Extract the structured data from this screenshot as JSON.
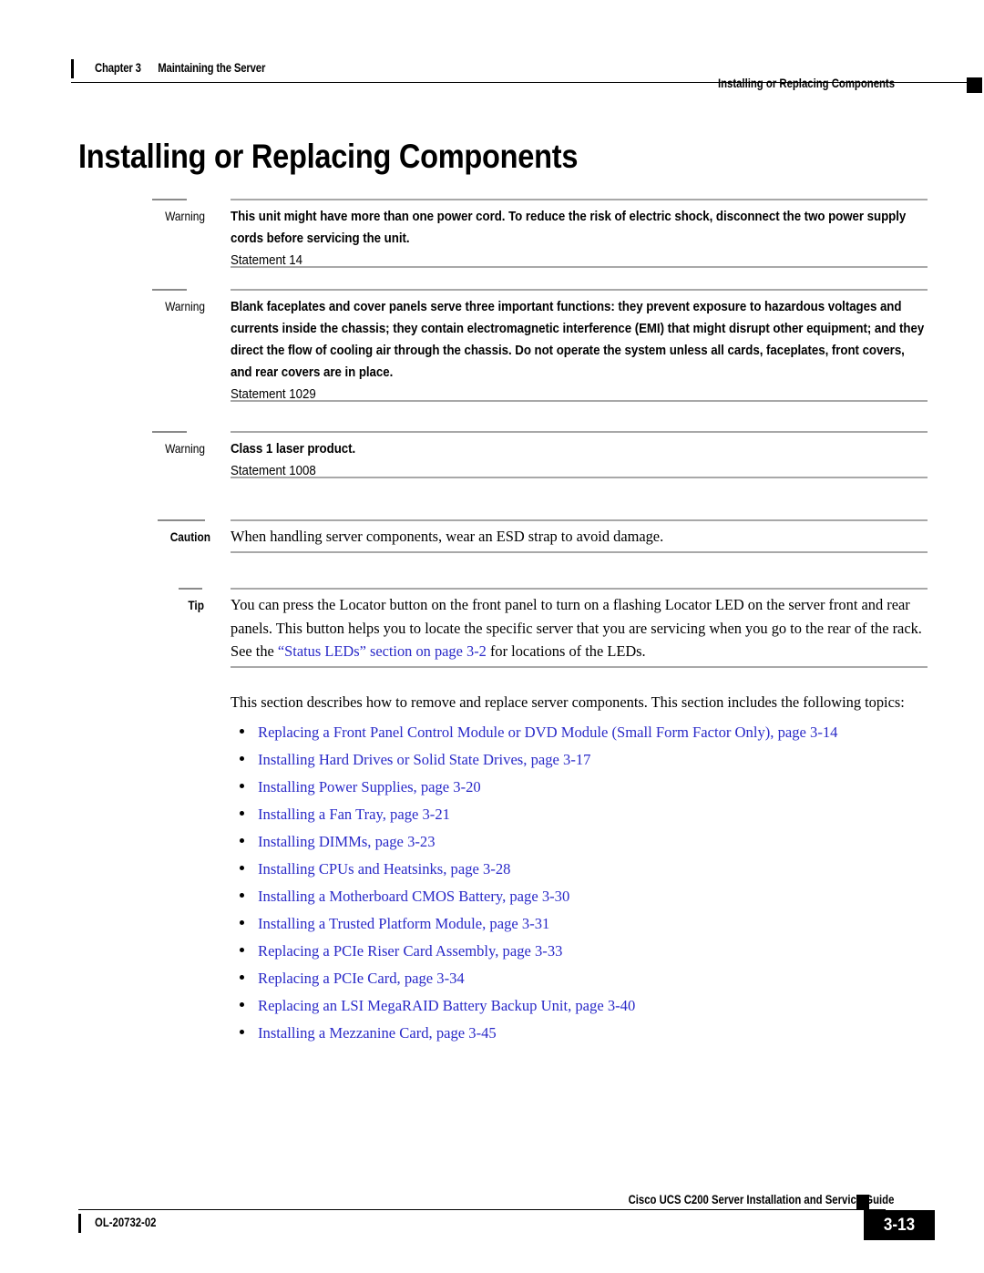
{
  "header": {
    "chapter": "Chapter 3",
    "chapter_title": "Maintaining the Server",
    "running_title": "Installing or Replacing Components"
  },
  "page_title": "Installing or Replacing Components",
  "admonitions": [
    {
      "label": "Warning",
      "body": "This unit might have more than one power cord. To reduce the risk of electric shock, disconnect the two power supply cords before servicing the unit.",
      "statement": "Statement 14",
      "style": "warning"
    },
    {
      "label": "Warning",
      "body": "Blank faceplates and cover panels serve three important functions: they prevent exposure to hazardous voltages and currents inside the chassis; they contain electromagnetic interference (EMI) that might disrupt other equipment; and they direct the flow of cooling air through the chassis. Do not operate the system unless all cards, faceplates, front covers, and rear covers are in place.",
      "statement": "Statement 1029",
      "style": "warning"
    },
    {
      "label": "Warning",
      "body": "Class 1 laser product.",
      "statement": "Statement 1008",
      "style": "warning"
    },
    {
      "label": "Caution",
      "body": "When handling server components, wear an ESD strap to avoid damage.",
      "statement": "",
      "style": "caution"
    },
    {
      "label": "Tip",
      "body_before_link": "You can press the Locator button on the front panel to turn on a flashing Locator LED on the server front and rear panels. This button helps you to locate the specific server that you are servicing when you go to the rear of the rack. See the ",
      "link_text": "“Status LEDs” section on page 3-2",
      "body_after_link": " for locations of the LEDs.",
      "style": "tip"
    }
  ],
  "intro_paragraph": "This section describes how to remove and replace server components. This section includes the following topics:",
  "topic_links": [
    "Replacing a Front Panel Control Module or DVD Module (Small Form Factor Only), page 3-14",
    "Installing Hard Drives or Solid State Drives, page 3-17",
    "Installing Power Supplies, page 3-20",
    "Installing a Fan Tray, page 3-21",
    "Installing DIMMs, page 3-23",
    "Installing CPUs and Heatsinks, page 3-28",
    "Installing a Motherboard CMOS Battery, page 3-30",
    "Installing a Trusted Platform Module, page 3-31",
    "Replacing a PCIe Riser Card Assembly, page 3-33",
    "Replacing a PCIe Card, page 3-34",
    "Replacing an LSI MegaRAID Battery Backup Unit, page 3-40",
    "Installing a Mezzanine Card, page 3-45"
  ],
  "footer": {
    "guide_title": "Cisco UCS C200 Server Installation and Service Guide",
    "doc_id": "OL-20732-02",
    "page_number": "3-13"
  },
  "colors": {
    "link": "#2a2ac8",
    "link_strong": "#3333cc",
    "rule": "#a8a8a8",
    "text": "#000000"
  }
}
